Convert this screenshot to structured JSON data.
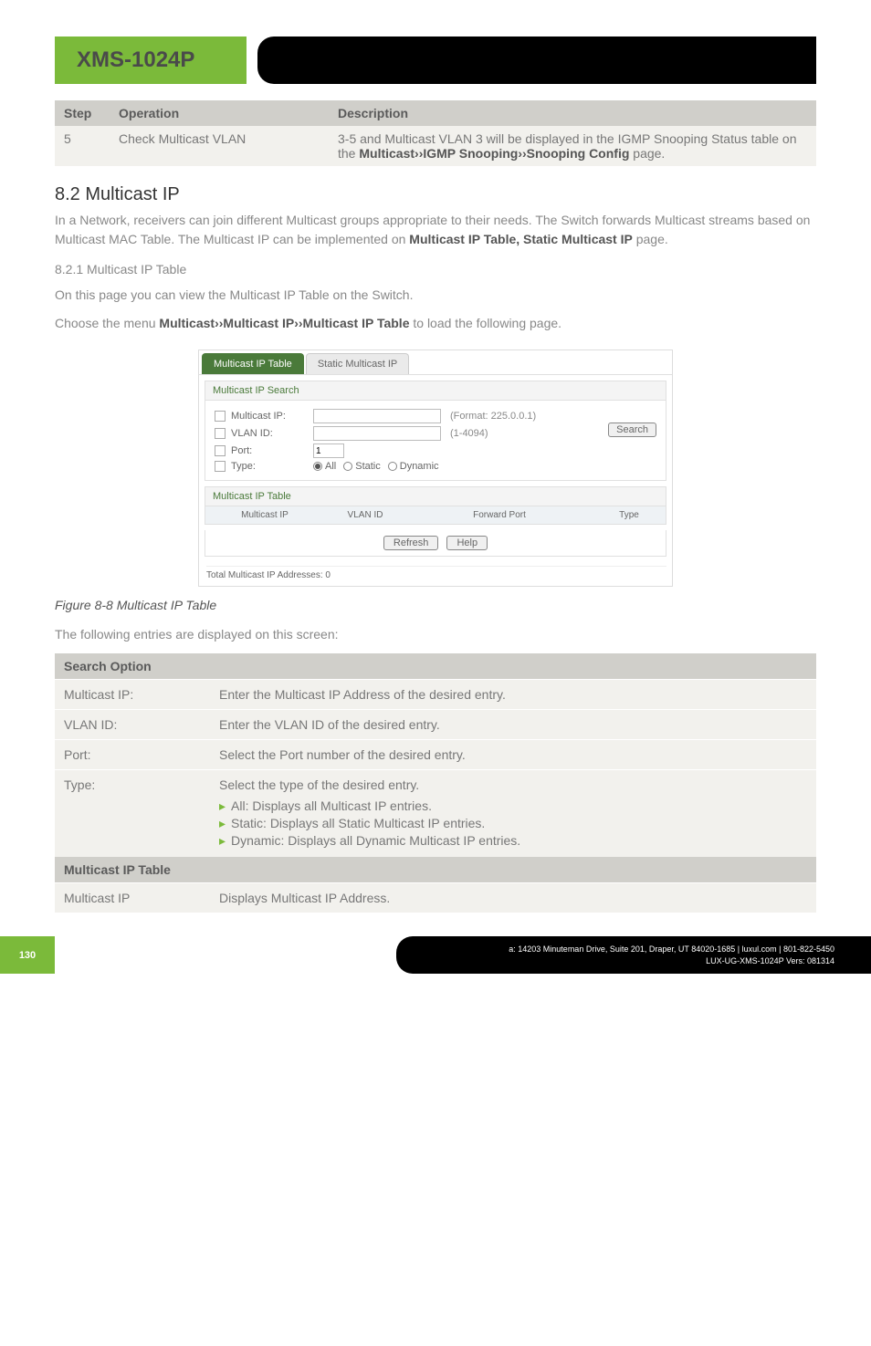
{
  "header": {
    "product": "XMS-1024P"
  },
  "step_table": {
    "headers": {
      "step": "Step",
      "operation": "Operation",
      "description": "Description"
    },
    "row": {
      "step": "5",
      "operation": "Check Multicast VLAN",
      "desc_pre": "3-5 and Multicast VLAN 3 will be displayed in the IGMP Snooping Status table on the ",
      "desc_bold1": "Multicast››IGMP Snooping››Snooping Config",
      "desc_post": " page."
    }
  },
  "section": {
    "title": "8.2 Multicast IP",
    "intro_pre": "In a Network, receivers can join different Multicast groups appropriate to their needs. The Switch forwards Multicast streams based on Multicast MAC Table. The Multicast IP can be implemented on ",
    "intro_bold": "Multicast IP Table, Static Multicast IP",
    "intro_post": " page.",
    "sub1": "8.2.1 Multicast IP Table",
    "sub1_text": "On this page you can view the Multicast IP Table on the Switch.",
    "choose_pre": "Choose the menu ",
    "choose_bold": "Multicast››Multicast IP››Multicast IP Table",
    "choose_post": " to load the following page."
  },
  "figure": {
    "tabs": {
      "active": "Multicast IP Table",
      "inactive": "Static Multicast IP"
    },
    "search_title": "Multicast IP Search",
    "labels": {
      "mip": "Multicast IP:",
      "vlan": "VLAN ID:",
      "port": "Port:",
      "type": "Type:"
    },
    "hints": {
      "mip_format": "(Format: 225.0.0.1)",
      "vlan_range": "(1-4094)"
    },
    "port_value": "1",
    "radios": {
      "all": "All",
      "static": "Static",
      "dynamic": "Dynamic"
    },
    "search_btn": "Search",
    "iptable_title": "Multicast IP Table",
    "cols": {
      "c1": "Multicast IP",
      "c2": "VLAN ID",
      "c3": "Forward Port",
      "c4": "Type"
    },
    "buttons": {
      "refresh": "Refresh",
      "help": "Help"
    },
    "footer": "Total Multicast IP Addresses: 0"
  },
  "caption": "Figure 8-8 Multicast IP Table",
  "entries_intro": "The following entries are displayed on this screen:",
  "opt": {
    "search_header": "Search Option",
    "rows": {
      "mip": {
        "label": "Multicast IP:",
        "desc": "Enter the Multicast IP Address of the desired entry."
      },
      "vlan": {
        "label": "VLAN ID:",
        "desc": "Enter the VLAN ID of the desired entry."
      },
      "port": {
        "label": "Port:",
        "desc": "Select the Port number of the desired entry."
      },
      "type": {
        "label": "Type:",
        "desc": "Select the type of the desired entry.",
        "bullets": {
          "b1": "All: Displays all Multicast IP entries.",
          "b2": "Static: Displays all Static Multicast IP entries.",
          "b3": "Dynamic: Displays all Dynamic Multicast IP entries."
        }
      }
    },
    "table_header": "Multicast IP Table",
    "mip_row": {
      "label": "Multicast IP",
      "desc": "Displays Multicast IP Address."
    }
  },
  "footer": {
    "page": "130",
    "line1": "a: 14203 Minuteman Drive, Suite 201, Draper, UT 84020-1685 | luxul.com | 801-822-5450",
    "line2": "LUX-UG-XMS-1024P  Vers: 081314"
  }
}
